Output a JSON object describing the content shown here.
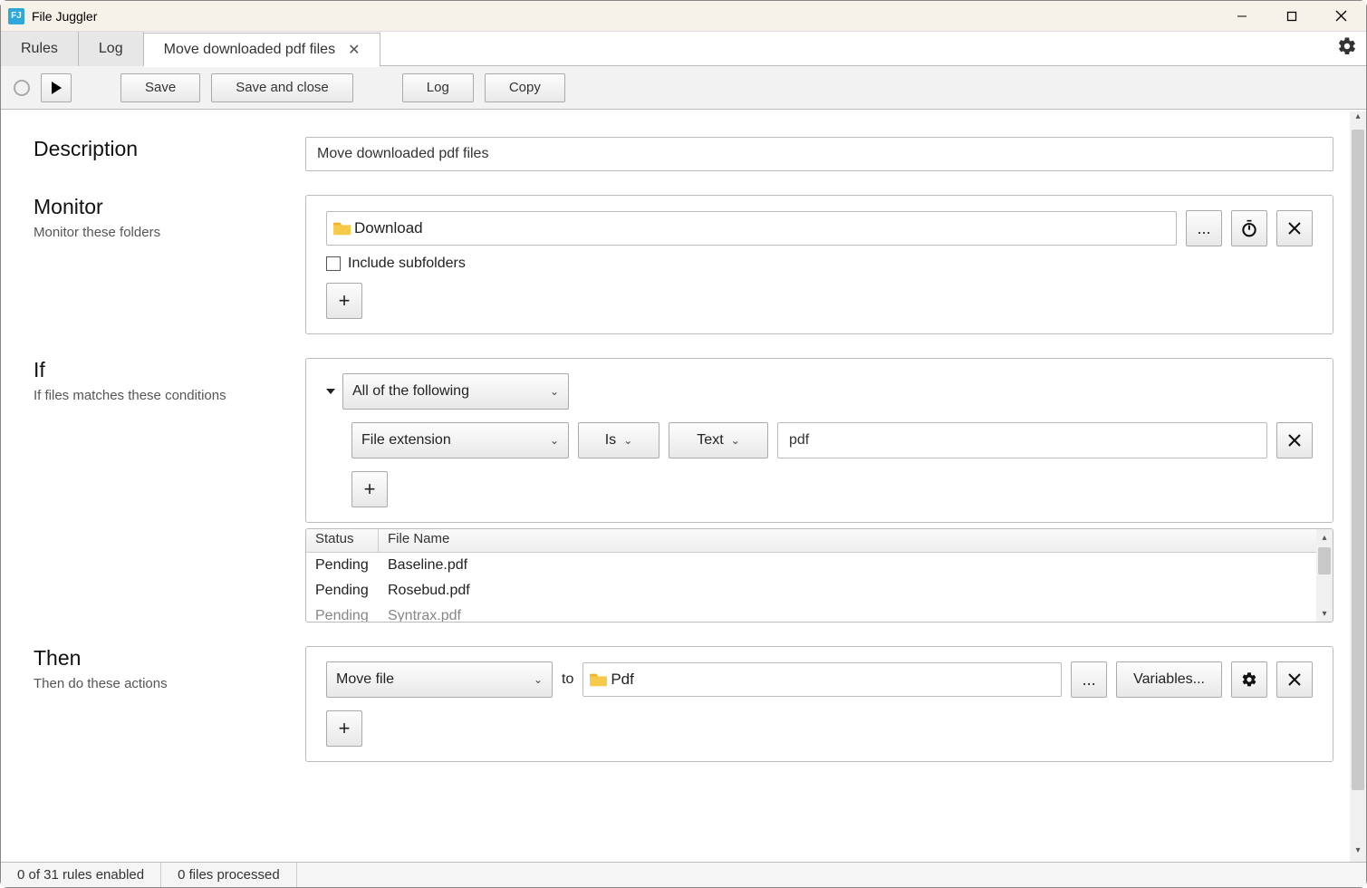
{
  "window": {
    "title": "File Juggler",
    "app_icon_text": "FJ"
  },
  "tabs": {
    "rules": "Rules",
    "log": "Log",
    "active": "Move downloaded pdf files"
  },
  "toolbar": {
    "save": "Save",
    "save_close": "Save and close",
    "log": "Log",
    "copy": "Copy"
  },
  "description": {
    "heading": "Description",
    "value": "Move downloaded pdf files"
  },
  "monitor": {
    "heading": "Monitor",
    "subtitle": "Monitor these folders",
    "folder": "Download",
    "browse": "...",
    "include_subfolders_label": "Include subfolders"
  },
  "if": {
    "heading": "If",
    "subtitle": "If files matches these conditions",
    "group_mode": "All of the following",
    "cond_field": "File extension",
    "cond_op": "Is",
    "cond_type": "Text",
    "cond_value": "pdf",
    "table": {
      "col_status": "Status",
      "col_name": "File Name",
      "rows": [
        {
          "status": "Pending",
          "name": "Baseline.pdf"
        },
        {
          "status": "Pending",
          "name": "Rosebud.pdf"
        },
        {
          "status": "Pending",
          "name": "Syntrax.pdf"
        }
      ]
    }
  },
  "then": {
    "heading": "Then",
    "subtitle": "Then do these actions",
    "action": "Move file",
    "to_label": "to",
    "dest": "Pdf",
    "browse": "...",
    "variables": "Variables..."
  },
  "statusbar": {
    "rules": "0 of 31 rules enabled",
    "files": "0 files processed"
  }
}
